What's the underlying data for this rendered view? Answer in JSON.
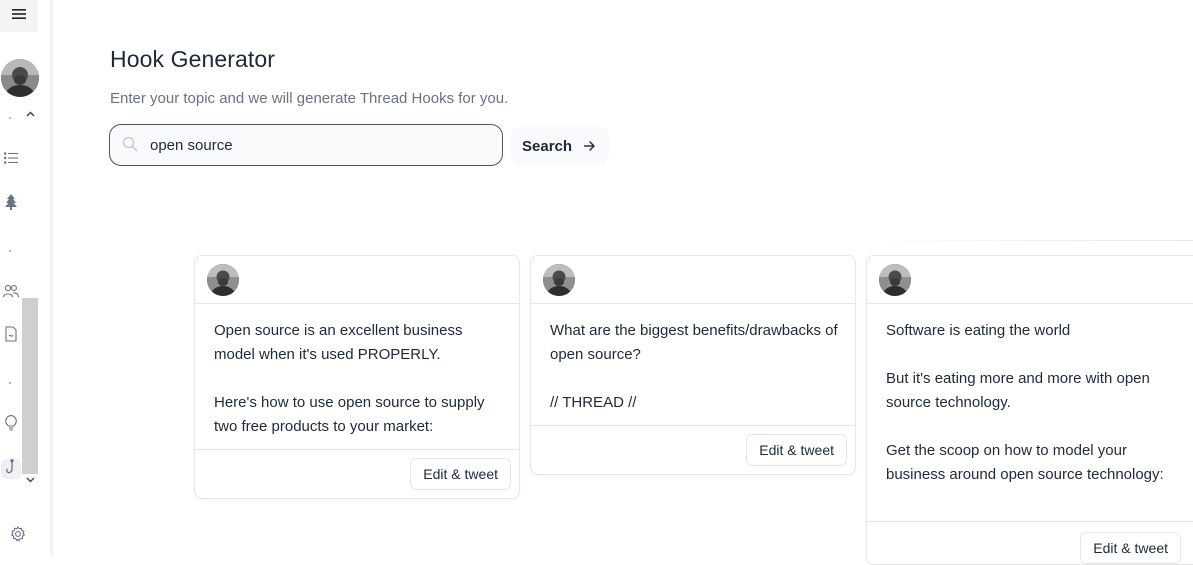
{
  "page": {
    "title": "Hook Generator",
    "subtitle": "Enter your topic and we will generate Thread Hooks for you."
  },
  "search": {
    "value": "open source",
    "placeholder": "",
    "button_label": "Search"
  },
  "sidebar": {
    "icons": [
      "menu-icon",
      "list-icon",
      "tree-icon",
      "users-icon",
      "document-icon",
      "lightbulb-icon",
      "hook-icon",
      "gear-icon"
    ]
  },
  "cards": [
    {
      "paragraphs": [
        "Open source is an excellent business model when it's used PROPERLY.",
        "Here's how to use open source to supply two free products to your market:"
      ],
      "button_label": "Edit & tweet"
    },
    {
      "paragraphs": [
        "What are the biggest benefits/drawbacks of open source?",
        "// THREAD //"
      ],
      "button_label": "Edit & tweet"
    },
    {
      "paragraphs": [
        "Software is eating the world",
        "But it's eating more and more with open source technology.",
        "Get the scoop on how to model your business around open source technology:"
      ],
      "button_label": "Edit & tweet"
    }
  ],
  "colors": {
    "text": "#1f2937",
    "muted": "#6b7280",
    "border": "#e5e7eb",
    "surface": "#f9fafb"
  }
}
